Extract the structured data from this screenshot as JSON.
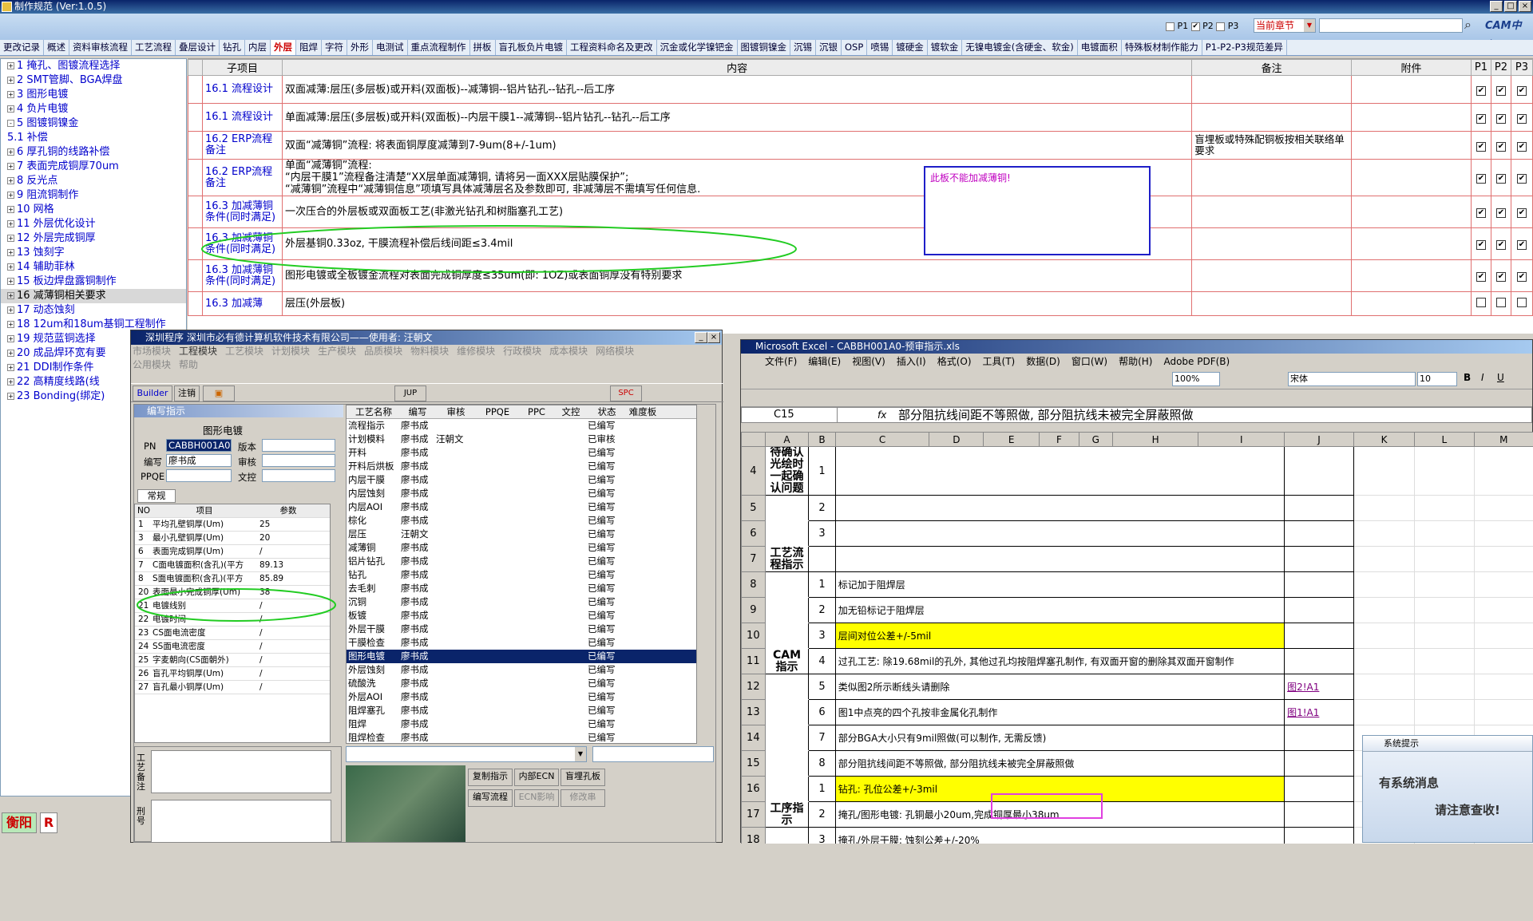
{
  "app": {
    "title": "制作规范 (Ver:1.0.5)"
  },
  "header": {
    "p1": "P1",
    "p2": "P2",
    "p3": "P3",
    "scope": "当前章节",
    "brand": "CAM中心"
  },
  "tabs": [
    "更改记录",
    "概述",
    "资料审核流程",
    "工艺流程",
    "叠层设计",
    "钻孔",
    "内层",
    "外层",
    "阻焊",
    "字符",
    "外形",
    "电测试",
    "重点流程制作",
    "拼板",
    "盲孔板负片电镀",
    "工程资料命名及更改",
    "沉金或化学镍钯金",
    "图镀铜镍金",
    "沉锡",
    "沉银",
    "OSP",
    "喷锡",
    "镀硬金",
    "镀软金",
    "无镍电镀金(含硬金、软金)",
    "电镀面积",
    "特殊板材制作能力",
    "P1-P2-P3规范差异"
  ],
  "active_tab": "外层",
  "tree": [
    {
      "pm": "+",
      "label": "1  掩孔、图镀流程选择"
    },
    {
      "pm": "+",
      "label": "2  SMT管脚、BGA焊盘"
    },
    {
      "pm": "+",
      "label": "3  图形电镀"
    },
    {
      "pm": "+",
      "label": "4  负片电镀"
    },
    {
      "pm": "-",
      "label": "5  图镀铜镍金"
    },
    {
      "pm": "",
      "label": "   5.1  补偿"
    },
    {
      "pm": "+",
      "label": "6  厚孔铜的线路补偿"
    },
    {
      "pm": "+",
      "label": "7  表面完成铜厚70um"
    },
    {
      "pm": "+",
      "label": "8  反光点"
    },
    {
      "pm": "+",
      "label": "9  阻流铜制作"
    },
    {
      "pm": "+",
      "label": "10  网格"
    },
    {
      "pm": "+",
      "label": "11  外层优化设计"
    },
    {
      "pm": "+",
      "label": "12  外层完成铜厚"
    },
    {
      "pm": "+",
      "label": "13  蚀刻字"
    },
    {
      "pm": "+",
      "label": "14  辅助菲林"
    },
    {
      "pm": "+",
      "label": "15  板边焊盘露铜制作"
    },
    {
      "pm": "+",
      "label": "16  减薄铜相关要求",
      "sel": true
    },
    {
      "pm": "+",
      "label": "17  动态蚀刻"
    },
    {
      "pm": "+",
      "label": "18  12um和18um基铜工程制作"
    },
    {
      "pm": "+",
      "label": "19  规范蓝铜选择"
    },
    {
      "pm": "+",
      "label": "20  成品焊环宽有要"
    },
    {
      "pm": "+",
      "label": "21  DDI制作条件"
    },
    {
      "pm": "+",
      "label": "22  高精度线路(线"
    },
    {
      "pm": "+",
      "label": "23  Bonding(绑定)"
    }
  ],
  "grid": {
    "headers": {
      "sub": "子项目",
      "content": "内容",
      "remark": "备注",
      "attach": "附件",
      "p1": "P1",
      "p2": "P2",
      "p3": "P3"
    },
    "rows": [
      {
        "sub": "16.1  流程设计",
        "content": "双面减薄:层压(多层板)或开料(双面板)--减薄铜--铝片钻孔--钻孔--后工序",
        "remark": ""
      },
      {
        "sub": "16.1  流程设计",
        "content": "单面减薄:层压(多层板)或开料(双面板)--内层干膜1--减薄铜--铝片钻孔--钻孔--后工序",
        "remark": ""
      },
      {
        "sub": "16.2  ERP流程备注",
        "content": "双面“减薄铜”流程: 将表面铜厚度减薄到7-9um(8+/-1um)",
        "remark": "盲埋板或特殊配铜板按相关联络单要求"
      },
      {
        "sub": "16.2  ERP流程备注",
        "content": "单面“减薄铜”流程:\n“内层干膜1”流程备注清楚“XX层单面减薄铜, 请将另一面XXX层贴膜保护”;\n“减薄铜”流程中“减薄铜信息”项填写具体减薄层名及参数即可, 非减薄层不需填写任何信息.",
        "remark": ""
      },
      {
        "sub": "16.3  加减薄铜条件(同时满足)",
        "content": "一次压合的外层板或双面板工艺(非激光钻孔和树脂塞孔工艺)",
        "remark": ""
      },
      {
        "sub": "16.3  加减薄铜条件(同时满足)",
        "content": "外层基铜0.33oz, 干膜流程补偿后线间距≤3.4mil",
        "remark": ""
      },
      {
        "sub": "16.3  加减薄铜条件(同时满足)",
        "content": "图形电镀或全板镀金流程对表面完成铜厚度≤35um(即: 1OZ)或表面铜厚没有特别要求",
        "remark": ""
      },
      {
        "sub": "16.3  加减薄",
        "content": "层压(外层板)",
        "remark": ""
      }
    ],
    "popup_note": "此板不能加减薄铜!"
  },
  "lower": {
    "title": "深圳程序     深圳市必有德计算机软件技术有限公司——使用者: 汪朝文",
    "menu1": [
      "市场模块",
      "工程模块",
      "工艺模块",
      "计划模块",
      "生产模块",
      "品质模块",
      "物料模块",
      "维修模块",
      "行政模块",
      "成本模块",
      "网络模块"
    ],
    "menu2": [
      "公用模块",
      "帮助"
    ],
    "toolbar": [
      "Builder",
      "注销",
      "JUP",
      "SPC"
    ],
    "panel_title": "编写指示",
    "form_title": "图形电镀",
    "labels": {
      "pn": "PN",
      "ver": "版本",
      "writer": "编写",
      "audit": "审核",
      "ppqe": "PPQE",
      "text": "文控",
      "tab": "常规"
    },
    "pn_value": "CABBH001A0",
    "writer_value": "廖书成",
    "param_headers": {
      "no": "NO",
      "item": "项目",
      "param": "参数"
    },
    "params": [
      {
        "no": "1",
        "item": "平均孔壁铜厚(Um)",
        "val": "25"
      },
      {
        "no": "3",
        "item": "最小孔壁铜厚(Um)",
        "val": "20"
      },
      {
        "no": "6",
        "item": "表面完成铜厚(Um)",
        "val": "/"
      },
      {
        "no": "7",
        "item": "C面电镀面积(含孔)(平方",
        "val": "89.13"
      },
      {
        "no": "8",
        "item": "S面电镀面积(含孔)(平方",
        "val": "85.89"
      },
      {
        "no": "20",
        "item": "表面最小完成铜厚(Um)",
        "val": "38"
      },
      {
        "no": "21",
        "item": "电镀线别",
        "val": "/"
      },
      {
        "no": "22",
        "item": "电镀时间",
        "val": "/"
      },
      {
        "no": "23",
        "item": "CS面电流密度",
        "val": "/"
      },
      {
        "no": "24",
        "item": "SS面电流密度",
        "val": "/"
      },
      {
        "no": "25",
        "item": "字麦朝向(CS面朝外)",
        "val": "/"
      },
      {
        "no": "26",
        "item": "盲孔平均铜厚(Um)",
        "val": "/"
      },
      {
        "no": "27",
        "item": "盲孔最小铜厚(Um)",
        "val": "/"
      }
    ],
    "proc_headers": [
      "工艺名称",
      "编写",
      "审核",
      "PPQE",
      "PPC",
      "文控",
      "状态",
      "难度板"
    ],
    "procs": [
      [
        "流程指示",
        "廖书成",
        "",
        "已编写"
      ],
      [
        "计划模料",
        "廖书成",
        "汪朝文",
        "已审核"
      ],
      [
        "开料",
        "廖书成",
        "",
        "已编写"
      ],
      [
        "开料后烘板",
        "廖书成",
        "",
        "已编写"
      ],
      [
        "内层干膜",
        "廖书成",
        "",
        "已编写"
      ],
      [
        "内层蚀刻",
        "廖书成",
        "",
        "已编写"
      ],
      [
        "内层AOI",
        "廖书成",
        "",
        "已编写"
      ],
      [
        "棕化",
        "廖书成",
        "",
        "已编写"
      ],
      [
        "层压",
        "汪朝文",
        "",
        "已编写"
      ],
      [
        "减薄铜",
        "廖书成",
        "",
        "已编写"
      ],
      [
        "铝片钻孔",
        "廖书成",
        "",
        "已编写"
      ],
      [
        "钻孔",
        "廖书成",
        "",
        "已编写"
      ],
      [
        "去毛刺",
        "廖书成",
        "",
        "已编写"
      ],
      [
        "沉铜",
        "廖书成",
        "",
        "已编写"
      ],
      [
        "板镀",
        "廖书成",
        "",
        "已编写"
      ],
      [
        "外层干膜",
        "廖书成",
        "",
        "已编写"
      ],
      [
        "干膜检查",
        "廖书成",
        "",
        "已编写"
      ],
      [
        "图形电镀",
        "廖书成",
        "",
        "已编写"
      ],
      [
        "外层蚀刻",
        "廖书成",
        "",
        "已编写"
      ],
      [
        "硫酸洗",
        "廖书成",
        "",
        "已编写"
      ],
      [
        "外层AOI",
        "廖书成",
        "",
        "已编写"
      ],
      [
        "阻焊塞孔",
        "廖书成",
        "",
        "已编写"
      ],
      [
        "阻焊",
        "廖书成",
        "",
        "已编写"
      ],
      [
        "阻焊检查",
        "廖书成",
        "",
        "已编写"
      ]
    ],
    "sel_proc": "图形电镀",
    "side_labels": {
      "a": "工艺备注",
      "b": "刑号"
    },
    "buttons": [
      "复制指示",
      "内部ECN",
      "盲埋孔板",
      "编写流程",
      "ECN影响",
      "修改串"
    ]
  },
  "excel": {
    "title": "Microsoft Excel - CABBH001A0-预审指示.xls",
    "menu": [
      "文件(F)",
      "编辑(E)",
      "视图(V)",
      "插入(I)",
      "格式(O)",
      "工具(T)",
      "数据(D)",
      "窗口(W)",
      "帮助(H)",
      "Adobe PDF(B)"
    ],
    "zoom": "100%",
    "font": "宋体",
    "size": "10",
    "cell_ref": "C15",
    "formula": "部分阻抗线间距不等照做, 部分阻抗线未被完全屏蔽照做",
    "cols": [
      "A",
      "B",
      "C",
      "D",
      "E",
      "F",
      "G",
      "H",
      "I",
      "J",
      "K",
      "L",
      "M"
    ],
    "rows": [
      {
        "r": "4",
        "a": "待确认光绘时一起确认问题",
        "b": "1",
        "text": ""
      },
      {
        "r": "5",
        "a": "",
        "b": "2",
        "text": ""
      },
      {
        "r": "6",
        "a": "",
        "b": "3",
        "text": ""
      },
      {
        "r": "7",
        "a": "工艺流程指示",
        "b": "",
        "text": ""
      },
      {
        "r": "8",
        "a": "",
        "b": "1",
        "text": "标记加于阻焊层"
      },
      {
        "r": "9",
        "a": "",
        "b": "2",
        "text": "加无铅标记于阻焊层"
      },
      {
        "r": "10",
        "a": "",
        "b": "3",
        "text": "层间对位公差+/-5mil",
        "yl": true
      },
      {
        "r": "11",
        "a": "CAM指示",
        "b": "4",
        "text": "过孔工艺: 除19.68mil的孔外, 其他过孔均按阻焊塞孔制作, 有双面开窗的删除其双面开窗制作"
      },
      {
        "r": "12",
        "a": "",
        "b": "5",
        "text": "类似图2所示断线头请删除",
        "link": "图2!A1"
      },
      {
        "r": "13",
        "a": "",
        "b": "6",
        "text": "图1中点亮的四个孔按非金属化孔制作",
        "link": "图1!A1"
      },
      {
        "r": "14",
        "a": "",
        "b": "7",
        "text": "部分BGA大小只有9mil照做(可以制作, 无需反馈)"
      },
      {
        "r": "15",
        "a": "",
        "b": "8",
        "text": "部分阻抗线间距不等照做, 部分阻抗线未被完全屏蔽照做"
      },
      {
        "r": "16",
        "a": "",
        "b": "1",
        "text": "钻孔: 孔位公差+/-3mil",
        "yl": true
      },
      {
        "r": "17",
        "a": "工序指示",
        "b": "2",
        "text": "掩孔/图形电镀: 孔铜最小20um,完成铜厚最小38um"
      },
      {
        "r": "18",
        "a": "",
        "b": "3",
        "text": "掩孔/外层干膜: 蚀刻公差+/-20%"
      }
    ]
  },
  "notice": {
    "title": "系统提示",
    "line1": "有系统消息",
    "line2": "请注意查收!"
  },
  "bottom": {
    "label": "衡阳",
    "r": "R"
  }
}
